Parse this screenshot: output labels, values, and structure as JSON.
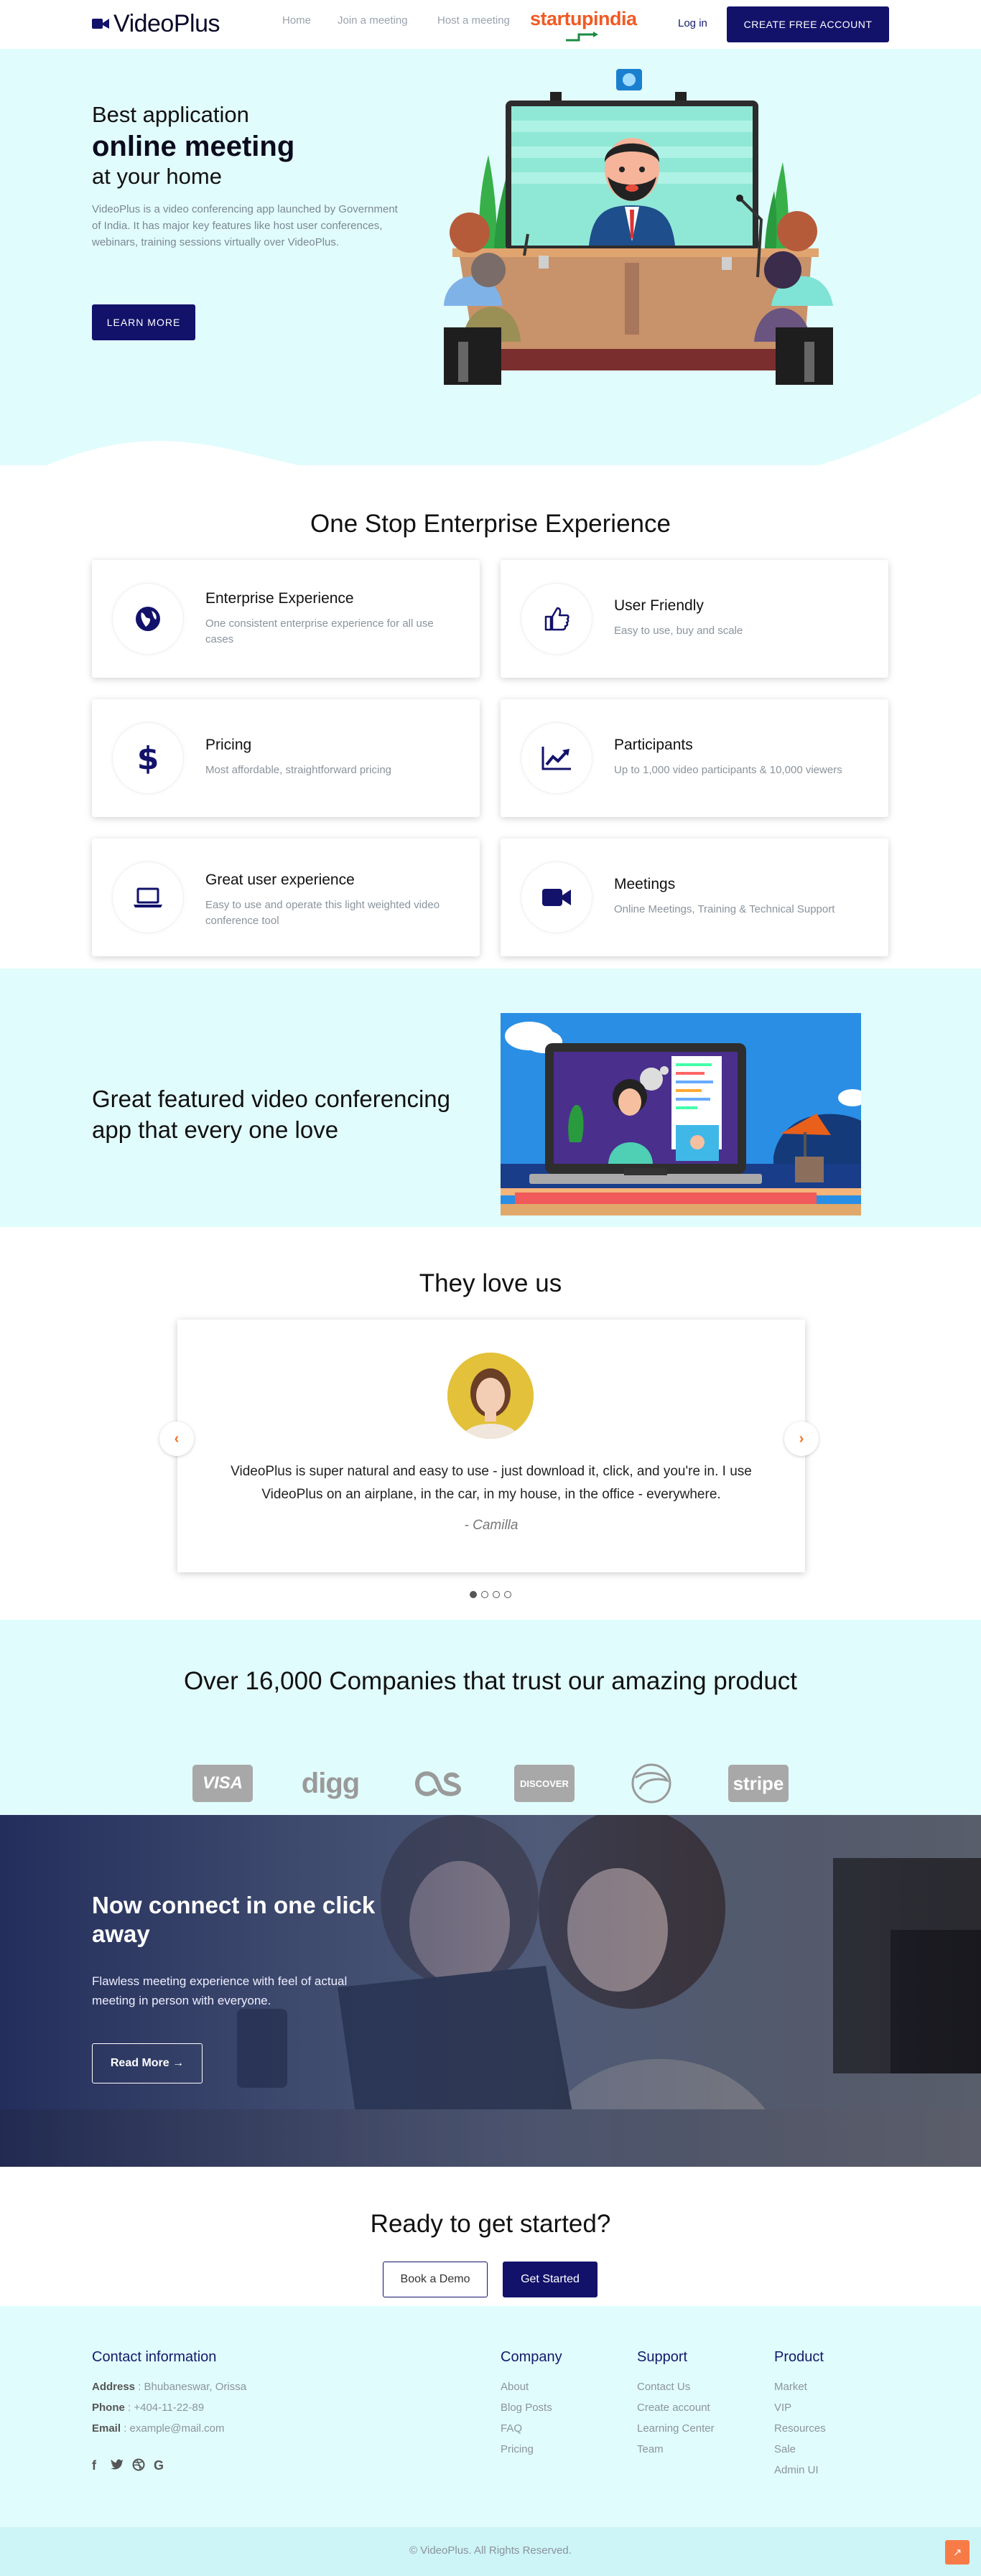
{
  "header": {
    "brand": "VideoPlus",
    "nav": [
      "Home",
      "Join a meeting",
      "Host a meeting"
    ],
    "partner_logo": "startupindia",
    "login": "Log in",
    "cta": "CREATE FREE ACCOUNT"
  },
  "hero": {
    "line1": "Best application",
    "line2": "online meeting",
    "line3": "at your home",
    "description": "VideoPlus is a video conferencing app launched by Government of India. It has major key features like host user conferences, webinars, training sessions virtually over VideoPlus.",
    "button": "LEARN MORE"
  },
  "enterprise": {
    "title": "One Stop Enterprise Experience",
    "cards": [
      {
        "icon": "globe-icon",
        "title": "Enterprise Experience",
        "desc": "One consistent enterprise experience for all use cases"
      },
      {
        "icon": "thumbs-up-icon",
        "title": "User Friendly",
        "desc": "Easy to use, buy and scale"
      },
      {
        "icon": "dollar-icon",
        "title": "Pricing",
        "desc": "Most affordable, straightforward pricing"
      },
      {
        "icon": "chart-line-icon",
        "title": "Participants",
        "desc": "Up to 1,000 video participants & 10,000 viewers"
      },
      {
        "icon": "laptop-icon",
        "title": "Great user experience",
        "desc": "Easy to use and operate this light weighted video conference tool"
      },
      {
        "icon": "video-camera-icon",
        "title": "Meetings",
        "desc": "Online Meetings, Training & Technical Support"
      }
    ]
  },
  "feature": {
    "title": "Great featured video conferencing app that every one love"
  },
  "testimonials": {
    "title": "They love us",
    "quote": "VideoPlus is super natural and easy to use - just download it, click, and you're in. I use VideoPlus on an airplane, in the car, in my house, in the office - everywhere.",
    "author": "- Camilla",
    "prev": "‹",
    "next": "›",
    "slides": 4,
    "active_slide": 1
  },
  "companies": {
    "title": "Over 16,000 Companies that trust our amazing product",
    "brands": [
      "VISA",
      "digg",
      "lastfm",
      "DISCOVER",
      "edge",
      "stripe"
    ]
  },
  "connect": {
    "title": "Now connect in one click away",
    "description": "Flawless meeting experience with feel of actual meeting in person with everyone.",
    "button": "Read More →"
  },
  "ready": {
    "title": "Ready to get started?",
    "demo": "Book a Demo",
    "start": "Get Started"
  },
  "footer": {
    "contact_title": "Contact information",
    "address_label": "Address",
    "address": " : Bhubaneswar, Orissa",
    "phone_label": "Phone",
    "phone": " : +404-11-22-89",
    "email_label": "Email",
    "email": " : example@mail.com",
    "social": [
      "facebook-icon",
      "twitter-icon",
      "dribbble-icon",
      "google-icon"
    ],
    "company": {
      "title": "Company",
      "links": [
        "About",
        "Blog Posts",
        "FAQ",
        "Pricing"
      ]
    },
    "support": {
      "title": "Support",
      "links": [
        "Contact Us",
        "Create account",
        "Learning Center",
        "Team"
      ]
    },
    "product": {
      "title": "Product",
      "links": [
        "Market",
        "VIP",
        "Resources",
        "Sale",
        "Admin UI"
      ]
    },
    "copyright": "© VideoPlus. All Rights Reserved.",
    "to_top": "↗"
  },
  "colors": {
    "primary": "#12126b",
    "mint": "#e1fcfc",
    "accent": "#f37021"
  }
}
